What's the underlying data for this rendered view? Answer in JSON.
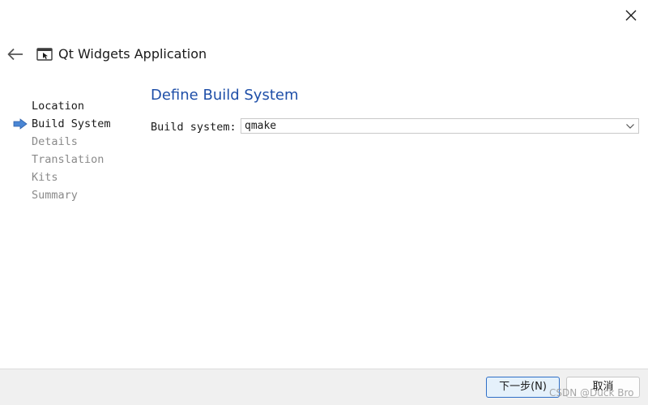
{
  "window": {
    "title": "Qt Widgets Application",
    "back_icon": "arrow-left-icon",
    "app_icon": "qt-widgets-application-icon",
    "close_icon": "close-icon"
  },
  "steps": [
    {
      "label": "Location",
      "state": "done"
    },
    {
      "label": "Build System",
      "state": "current"
    },
    {
      "label": "Details",
      "state": "pending"
    },
    {
      "label": "Translation",
      "state": "pending"
    },
    {
      "label": "Kits",
      "state": "pending"
    },
    {
      "label": "Summary",
      "state": "pending"
    }
  ],
  "page": {
    "title": "Define Build System",
    "build_system_label": "Build system:",
    "build_system_value": "qmake"
  },
  "buttons": {
    "next": "下一步(N)",
    "cancel": "取消"
  },
  "watermark": "CSDN @Duck Bro",
  "colors": {
    "accent": "#1f4fa8",
    "step_arrow": "#4a86d4",
    "pending_text": "#8a8a8a"
  }
}
